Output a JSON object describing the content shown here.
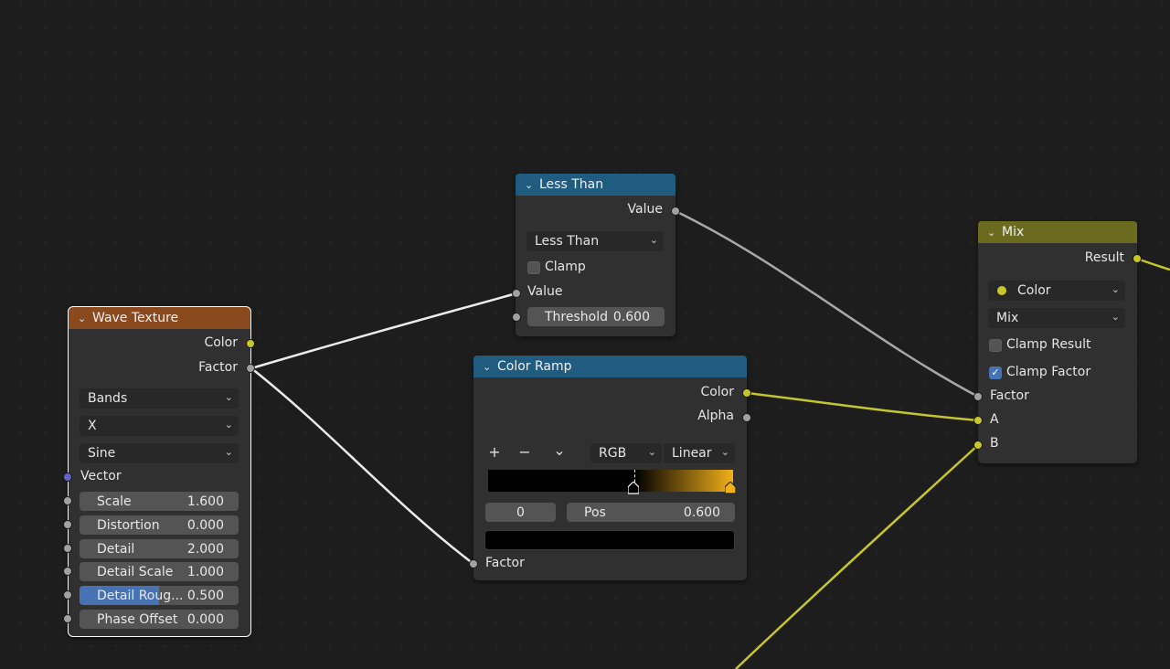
{
  "nodes": {
    "wave_texture": {
      "title": "Wave Texture",
      "header_color": "#8b4a1d",
      "outputs": {
        "color": "Color",
        "factor": "Factor"
      },
      "wave_type": "Bands",
      "direction": "X",
      "profile": "Sine",
      "inputs": {
        "vector": "Vector",
        "scale": {
          "label": "Scale",
          "value": "1.600"
        },
        "distortion": {
          "label": "Distortion",
          "value": "0.000"
        },
        "detail": {
          "label": "Detail",
          "value": "2.000"
        },
        "detail_scale": {
          "label": "Detail Scale",
          "value": "1.000"
        },
        "detail_roughness": {
          "label": "Detail Roug...",
          "value": "0.500",
          "fill_fraction": 0.5
        },
        "phase_offset": {
          "label": "Phase Offset",
          "value": "0.000"
        }
      }
    },
    "less_than": {
      "title": "Less Than",
      "header_color": "#1f5c80",
      "output": "Value",
      "operation": "Less Than",
      "clamp_label": "Clamp",
      "clamp_checked": false,
      "input_value": "Value",
      "threshold": {
        "label": "Threshold",
        "value": "0.600"
      }
    },
    "color_ramp": {
      "title": "Color Ramp",
      "header_color": "#1f5c80",
      "outputs": {
        "color": "Color",
        "alpha": "Alpha"
      },
      "add_label": "+",
      "remove_label": "−",
      "menu_label": "⌄",
      "color_mode": "RGB",
      "interpolation": "Linear",
      "stop_index": "0",
      "pos": {
        "label": "Pos",
        "value": "0.600"
      },
      "stop_color": "#000000",
      "ramp_end_color": "#f2b019",
      "input_factor": "Factor"
    },
    "mix": {
      "title": "Mix",
      "header_color": "#6b6b1f",
      "output": "Result",
      "data_type": "Color",
      "blend_mode": "Mix",
      "clamp_result_label": "Clamp Result",
      "clamp_result_checked": false,
      "clamp_factor_label": "Clamp Factor",
      "clamp_factor_checked": true,
      "inputs": {
        "factor": "Factor",
        "a": "A",
        "b": "B"
      }
    }
  },
  "colors": {
    "socket_float": "#a1a1a1",
    "socket_color": "#c7c729",
    "socket_vector": "#6363c7",
    "wire_float": "#a8a8a8",
    "wire_color": "#c5c530",
    "wire_selected": "#ececec",
    "checkbox_on": "#4772b3"
  },
  "icons": {
    "collapse": "chevron-down-icon",
    "dropdown": "chevron-down-icon",
    "checkmark": "checkmark-icon"
  }
}
